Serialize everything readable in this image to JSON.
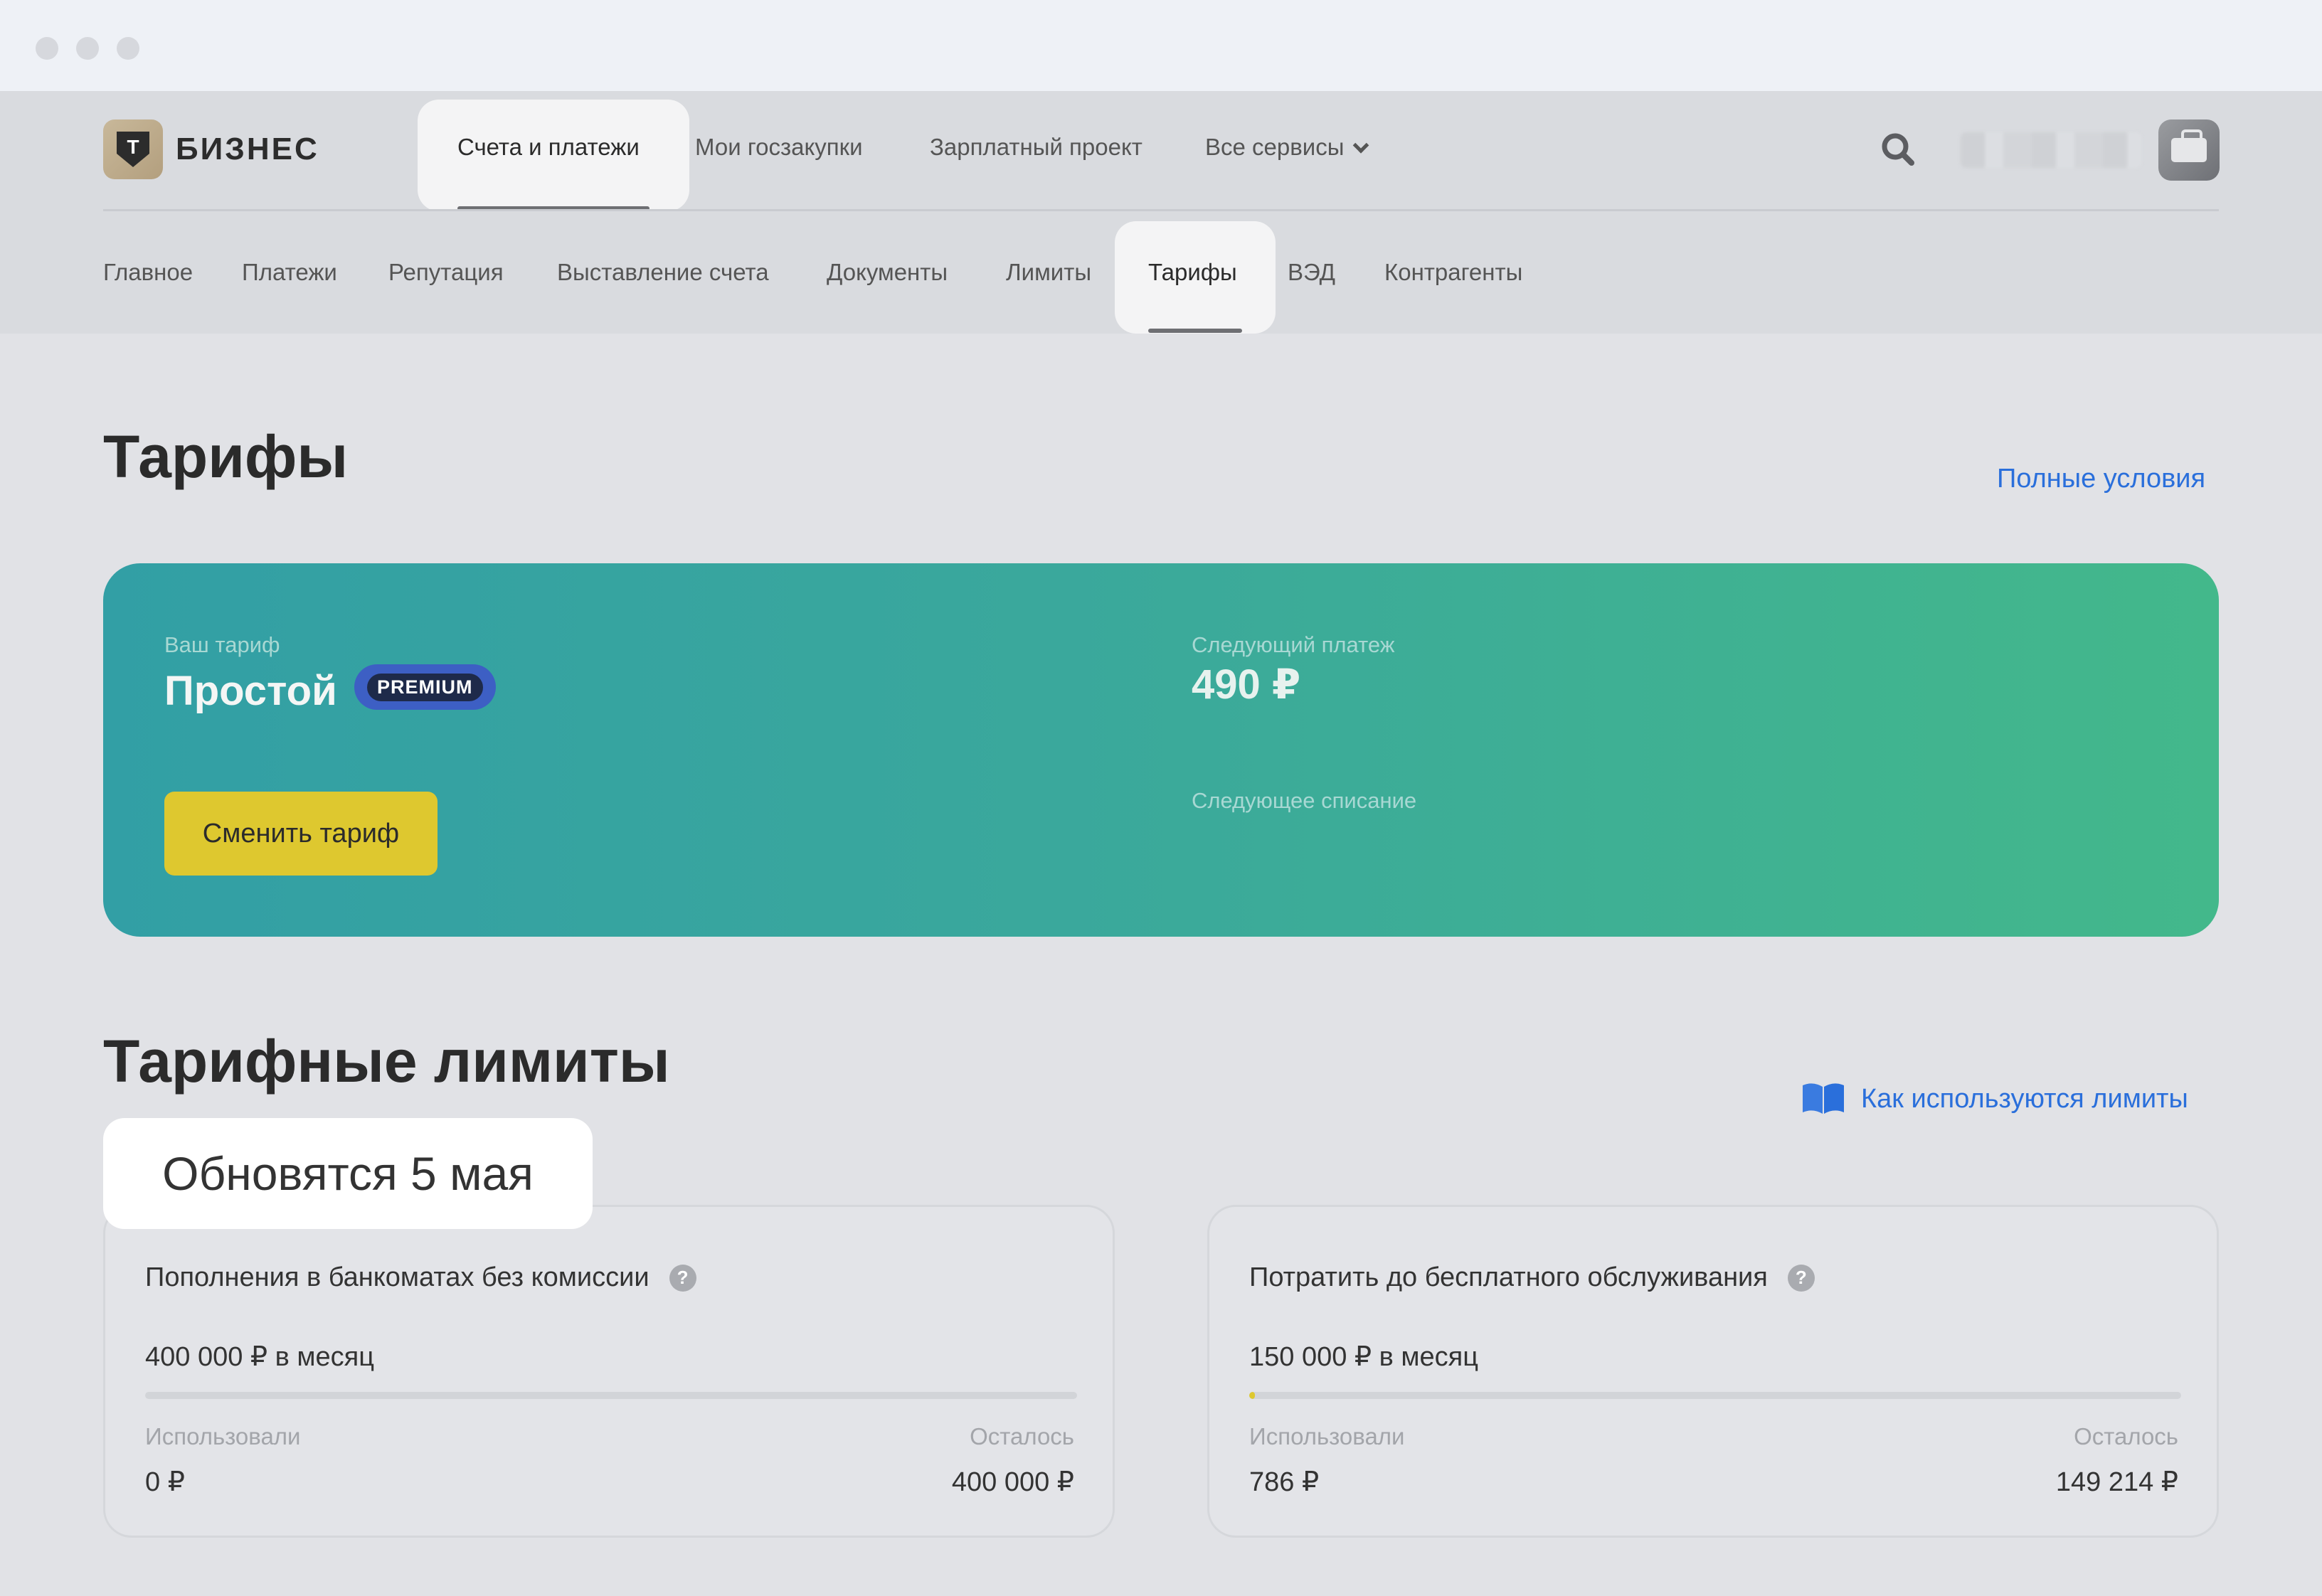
{
  "header": {
    "logo_text": "БИЗНЕС",
    "logo_letter": "Т",
    "top_nav": [
      {
        "label": "Счета и платежи",
        "active": true
      },
      {
        "label": "Мои госзакупки"
      },
      {
        "label": "Зарплатный проект"
      },
      {
        "label": "Все сервисы"
      }
    ],
    "sub_nav": [
      {
        "label": "Главное"
      },
      {
        "label": "Платежи"
      },
      {
        "label": "Репутация"
      },
      {
        "label": "Выставление счета"
      },
      {
        "label": "Документы"
      },
      {
        "label": "Лимиты"
      },
      {
        "label": "Тарифы",
        "active": true
      },
      {
        "label": "ВЭД"
      },
      {
        "label": "Контрагенты"
      }
    ]
  },
  "page": {
    "title": "Тарифы",
    "full_terms_link": "Полные условия"
  },
  "tariff_card": {
    "your_tariff_label": "Ваш тариф",
    "plan_name": "Простой",
    "badge": "PREMIUM",
    "next_payment_label": "Следующий платеж",
    "next_payment_amount": "490 ₽",
    "next_charge_label": "Следующее списание",
    "change_button": "Сменить тариф"
  },
  "limits": {
    "title": "Тарифные лимиты",
    "how_used_link": "Как используются лимиты",
    "update_badge": "Обновятся 5 мая",
    "cards": [
      {
        "title": "Пополнения в банкоматах без комиссии",
        "amount": "400 000 ₽ в месяц",
        "used_label": "Использовали",
        "used_value": "0 ₽",
        "left_label": "Осталось",
        "left_value": "400 000 ₽",
        "progress_fraction": 0
      },
      {
        "title": "Потратить до бесплатного обслуживания",
        "amount": "150 000 ₽ в месяц",
        "used_label": "Использовали",
        "used_value": "786 ₽",
        "left_label": "Осталось",
        "left_value": "149 214 ₽",
        "progress_fraction": 0.00524
      }
    ]
  },
  "colors": {
    "accent_link": "#2a6fdb",
    "button_yellow": "#dec82f",
    "card_gradient_start": "#329fa5",
    "card_gradient_end": "#43b88b",
    "premium_badge": "#3d5fc4"
  },
  "icons": [
    "search-icon",
    "chevron-down-icon",
    "avatar-briefcase-icon",
    "book-icon",
    "help-icon"
  ]
}
